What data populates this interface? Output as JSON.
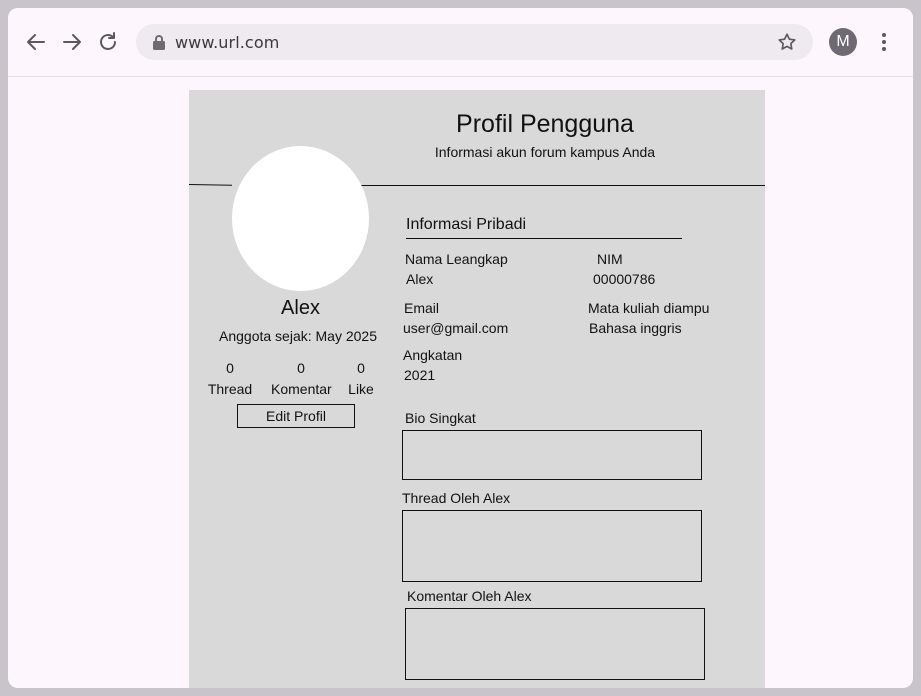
{
  "browser": {
    "url": "www.url.com",
    "profile_initial": "M"
  },
  "header": {
    "title": "Profil Pengguna",
    "subtitle": "Informasi akun forum kampus Anda"
  },
  "profile": {
    "name": "Alex",
    "member_since": "Anggota sejak: May 2025",
    "stats": [
      {
        "value": "0",
        "label": "Thread"
      },
      {
        "value": "0",
        "label": "Komentar"
      },
      {
        "value": "0",
        "label": "Like"
      }
    ],
    "edit_label": "Edit Profil"
  },
  "personal_info": {
    "heading": "Informasi Pribadi",
    "full_name_label": "Nama Leangkap",
    "full_name_value": "Alex",
    "nim_label": "NIM",
    "nim_value": "00000786",
    "email_label": "Email",
    "email_value": "user@gmail.com",
    "course_label": "Mata kuliah diampu",
    "course_value": "Bahasa inggris",
    "year_label": "Angkatan",
    "year_value": "2021"
  },
  "sections": {
    "bio_label": "Bio Singkat",
    "threads_label": "Thread Oleh Alex",
    "comments_label": "Komentar Oleh Alex"
  }
}
